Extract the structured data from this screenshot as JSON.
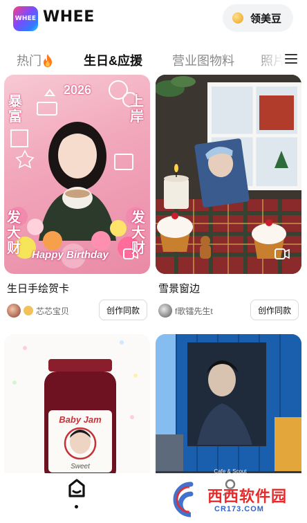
{
  "header": {
    "logo_text": "WHEE",
    "app_name": "WHEE",
    "beans_label": "领美豆"
  },
  "tabs": [
    {
      "label": "热门",
      "icon": "fire-icon"
    },
    {
      "label": "生日&应援",
      "active": true
    },
    {
      "label": "营业图物料"
    },
    {
      "label": "照片"
    }
  ],
  "cards": [
    {
      "title": "生日手绘贺卡",
      "author": "芯芯宝贝",
      "create_label": "创作同款",
      "image_text": {
        "year": "2026",
        "left_top": "暴富",
        "right_top": "上岸",
        "left_bottom": "发大财",
        "right_bottom": "发大财",
        "banner": "Happy Birthday"
      }
    },
    {
      "title": "雪景窗边",
      "author": "f歌镭先生t",
      "create_label": "创作同款"
    },
    {
      "jar_text": {
        "brand": "Baby Jam",
        "sub": "Sweet"
      }
    },
    {
      "sign": "Cafe & Scout"
    }
  ],
  "bottom_nav": {
    "home": "home-icon",
    "profile": "profile-icon"
  },
  "watermark": {
    "brand": "西西软件园",
    "url": "CR173.COM"
  },
  "colors": {
    "accent_gradient_start": "#ff3d7f",
    "accent_gradient_end": "#26d1ff",
    "tab_inactive": "#8a8a8a"
  }
}
